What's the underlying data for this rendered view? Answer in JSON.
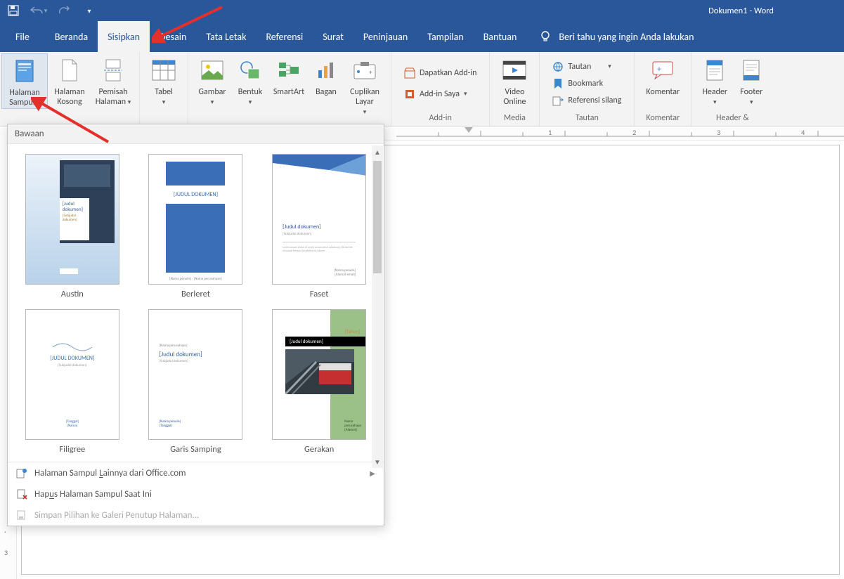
{
  "title": "Dokumen1  -  Word",
  "qat": {
    "save_tip": "Save",
    "undo": "Undo",
    "redo": "Redo",
    "customize": "Customize"
  },
  "tabs": {
    "file": "File",
    "home": "Beranda",
    "insert": "Sisipkan",
    "design": "Desain",
    "layout": "Tata Letak",
    "references": "Referensi",
    "mailings": "Surat",
    "review": "Peninjauan",
    "view": "Tampilan",
    "help": "Bantuan",
    "tell": "Beri tahu yang ingin Anda lakukan"
  },
  "ribbon": {
    "pages": {
      "cover": "Halaman Sampul",
      "blank": "Halaman Kosong",
      "break": "Pemisah Halaman"
    },
    "tables": {
      "table": "Tabel"
    },
    "illustrations": {
      "pictures": "Gambar",
      "shapes": "Bentuk",
      "smartart": "SmartArt",
      "chart": "Bagan",
      "screenshot": "Cuplikan Layar"
    },
    "addins": {
      "get": "Dapatkan Add-in",
      "my": "Add-in Saya",
      "label": "Add-in"
    },
    "media": {
      "video": "Video Online",
      "label": "Media"
    },
    "links": {
      "link": "Tautan",
      "bookmark": "Bookmark",
      "crossref": "Referensi silang",
      "label": "Tautan"
    },
    "comments": {
      "comment": "Komentar",
      "label": "Komentar"
    },
    "headerfooter": {
      "header": "Header",
      "footer": "Footer",
      "label": "Header & "
    }
  },
  "gallery": {
    "header": "Bawaan",
    "items": [
      {
        "name": "Austin"
      },
      {
        "name": "Berleret"
      },
      {
        "name": "Faset"
      },
      {
        "name": "Filigree"
      },
      {
        "name": "Garis Samping"
      },
      {
        "name": "Gerakan"
      }
    ],
    "more": "Halaman Sampul Lainnya dari Office.com",
    "remove": "Hapus Halaman Sampul Saat Ini",
    "save": "Simpan Pilihan ke Galeri Penutup Halaman...",
    "thumbs": {
      "judul": "[Judul dokumen]",
      "judul2": "[JUDUL DOKUMEN]",
      "tahun": "[Tahun]"
    }
  },
  "ruler": {
    "n1": "1",
    "n2": "2",
    "n3": "3",
    "n4": "4"
  }
}
